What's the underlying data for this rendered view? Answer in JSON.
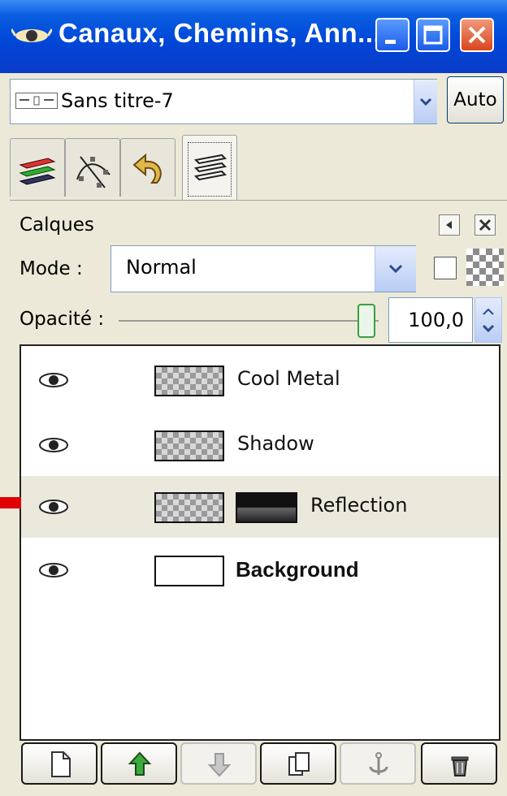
{
  "window": {
    "title": "Canaux, Chemins, Ann...",
    "controls": [
      "minimize-button",
      "maximize-button",
      "close-button"
    ]
  },
  "image_selector": {
    "value": "Sans titre-7",
    "auto_label": "Auto"
  },
  "tabs": [
    {
      "name": "channels",
      "icon": "channels-icon"
    },
    {
      "name": "paths",
      "icon": "paths-icon"
    },
    {
      "name": "undo-history",
      "icon": "undo-icon"
    },
    {
      "name": "layers",
      "icon": "layers-icon",
      "active": true
    }
  ],
  "panel": {
    "title": "Calques",
    "mode_label": "Mode :",
    "mode_value": "Normal",
    "opacity_label": "Opacité :",
    "opacity_value": "100,0",
    "opacity_fraction": 1.0
  },
  "layers": [
    {
      "name": "Cool Metal",
      "visible": true,
      "bold": false,
      "selected": false,
      "has_mask": false
    },
    {
      "name": "Shadow",
      "visible": true,
      "bold": false,
      "selected": false,
      "has_mask": false
    },
    {
      "name": "Reflection",
      "visible": true,
      "bold": false,
      "selected": true,
      "has_mask": true
    },
    {
      "name": "Background",
      "visible": true,
      "bold": true,
      "selected": false,
      "has_mask": false
    }
  ],
  "bottom_buttons": [
    {
      "name": "new-layer",
      "icon": "new-layer-icon",
      "enabled": true
    },
    {
      "name": "raise-layer",
      "icon": "up-arrow-icon",
      "enabled": true
    },
    {
      "name": "lower-layer",
      "icon": "down-arrow-icon",
      "enabled": false
    },
    {
      "name": "duplicate-layer",
      "icon": "duplicate-icon",
      "enabled": true
    },
    {
      "name": "anchor-layer",
      "icon": "anchor-icon",
      "enabled": false
    },
    {
      "name": "delete-layer",
      "icon": "trash-icon",
      "enabled": true
    }
  ],
  "colors": {
    "titlebar": "#0047d8",
    "close": "#d9451e",
    "selected_row": "#ebe9dc",
    "marker": "#e00000"
  }
}
